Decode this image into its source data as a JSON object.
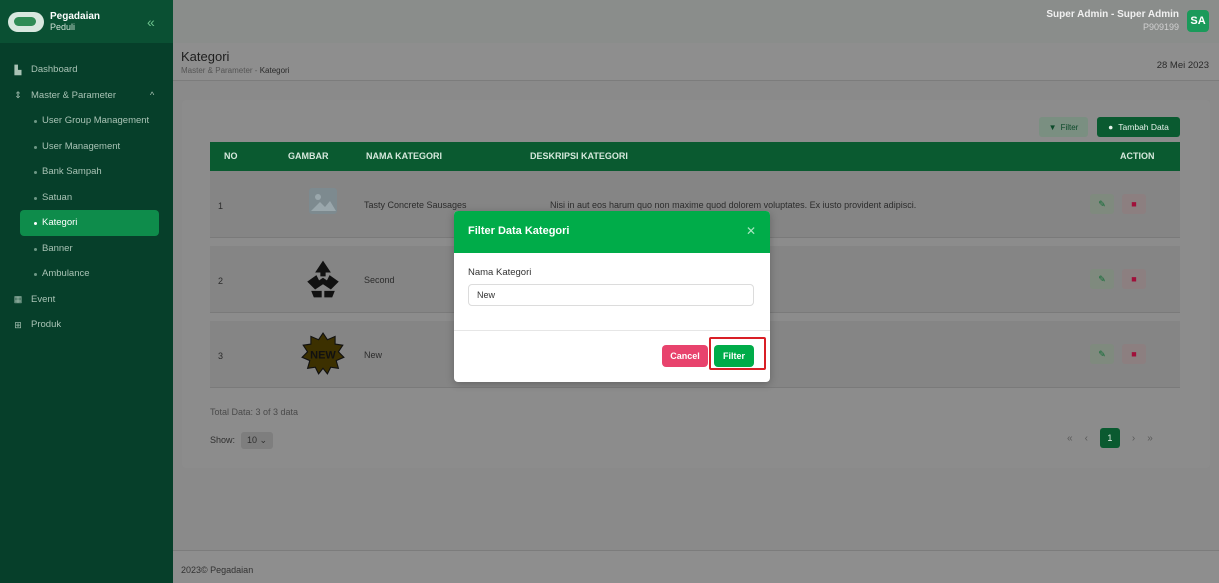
{
  "brand": {
    "name": "Pegadaian",
    "sub": "Peduli"
  },
  "header": {
    "user": "Super Admin - Super Admin",
    "user_id": "P909199",
    "avatar": "SA"
  },
  "sidebar": {
    "items": [
      {
        "label": "Dashboard",
        "icon": "dashboard-icon"
      },
      {
        "label": "Master & Parameter",
        "icon": "parameter-icon"
      },
      {
        "label": "User Group Management"
      },
      {
        "label": "User Management"
      },
      {
        "label": "Bank Sampah"
      },
      {
        "label": "Satuan"
      },
      {
        "label": "Kategori"
      },
      {
        "label": "Banner"
      },
      {
        "label": "Ambulance"
      },
      {
        "label": "Event",
        "icon": "calendar-icon"
      },
      {
        "label": "Produk",
        "icon": "grid-icon"
      }
    ]
  },
  "page": {
    "title": "Kategori",
    "breadcrumb_parent": "Master & Parameter",
    "breadcrumb_current": "Kategori",
    "date": "28 Mei 2023"
  },
  "toolbar": {
    "filter_label": "Filter",
    "add_label": "Tambah Data"
  },
  "table": {
    "columns": [
      "NO",
      "GAMBAR",
      "NAMA KATEGORI",
      "DESKRIPSI KATEGORI",
      "ACTION"
    ],
    "rows": [
      {
        "no": "1",
        "name": "Tasty Concrete Sausages",
        "desc": "Nisi in aut eos harum quo non maxime quod dolorem voluptates. Ex iusto provident adipisci."
      },
      {
        "no": "2",
        "name": "Second",
        "desc": ""
      },
      {
        "no": "3",
        "name": "New",
        "desc": ""
      }
    ]
  },
  "pagination": {
    "total": "Total Data: 3 of 3 data",
    "show_label": "Show:",
    "show_value": "10",
    "current": "1"
  },
  "footer": "2023© Pegadaian",
  "modal": {
    "title": "Filter Data Kategori",
    "field_label": "Nama Kategori",
    "field_value": "New",
    "cancel": "Cancel",
    "filter": "Filter"
  },
  "colors": {
    "primary": "#00ac49",
    "sidebar": "#063f2a",
    "danger": "#e8436d",
    "highlight": "#d91f26"
  }
}
